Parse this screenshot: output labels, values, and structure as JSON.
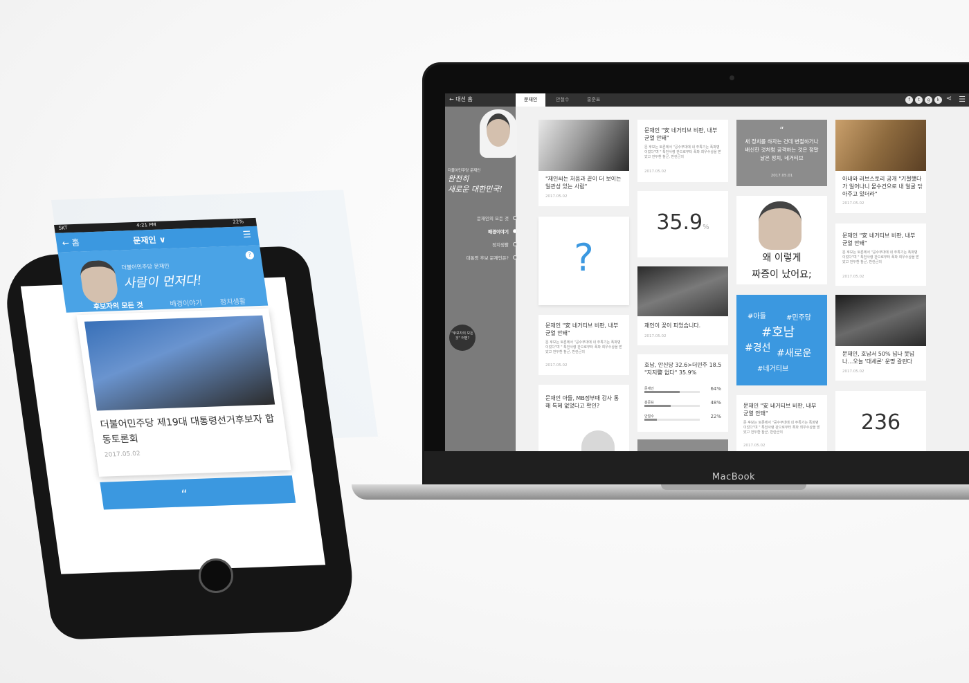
{
  "laptop": {
    "brand": "MacBook",
    "topbar": {
      "back": "대선 홈",
      "tabs": [
        "문재인",
        "안철수",
        "홍준표"
      ],
      "social_icons": [
        "facebook-icon",
        "twitter-icon",
        "googleplus-icon",
        "kakao-icon"
      ]
    },
    "sidebar": {
      "sub": "더불어민주당 문재인",
      "slogan_line1": "완전히",
      "slogan_line2": "새로운 대한민국!",
      "menu": [
        "문재인의 모든 것",
        "배경이야기",
        "정치생활",
        "대통령 후보 문재인은?"
      ],
      "bubble": "\"후보자의 모든것\" 어땐?"
    },
    "cards": {
      "c1_title": "\"재인씨는 처음과 끝이 더 보이는 일관성 있는 사람\"",
      "c1_date": "2017.05.02",
      "c2_title": "문재인 \"安 네거티브 비판, 내부 균열 안돼\"",
      "c2_body": "문 후보는 토론에서 \"공수부대에 내 주특기는 폭파병이었다\"며 \" 특전사령 관으로부터 폭파 최우수상을 받았고 전두환 참군, 반란군의",
      "c2_date": "2017.05.02",
      "c3_quote": "새 정치를 하자는 건데 변절하거나 배신한 것처럼 공격하는 것은 정말 낡은 정치, 네거티브",
      "c3_date": "2017.05.01",
      "c4_title": "아내와 러브스토리 공개 \"기절했다가 일어나니 물수건으로 내 얼굴 닦아주고 있더라\"",
      "c4_date": "2017.05.02",
      "c5_number": "35.9",
      "c5_unit": "%",
      "c6_line1": "왜 이렇게",
      "c6_line2": "짜증이 났어요;",
      "c7_title": "문재인 \"安 네거티브 비판, 내부 균열 안돼\"",
      "c7_body": "문 후보는 토론에서 \"공수부대에 내 주특기는 폭파병이었다\"며 \" 특전사령 관으로부터 폭파 최우수상을 받았고 전두환 참군, 반란군의",
      "c7_date": "2017.05.02",
      "c8_mark": "?",
      "c9_title": "재인이 꽃이 피었습니다.",
      "c9_date": "2017.05.02",
      "c10_tags": [
        "#아들",
        "#민주당",
        "#호남",
        "#경선",
        "#새로운",
        "#네거티브"
      ],
      "c11_title": "문재인, 호남서 50% 넘나 못넘나…오늘 '대세론' 운명 갈린다",
      "c11_date": "2017.05.02",
      "c12_title": "문재인 \"安 네거티브 비판, 내부 균열 안돼\"",
      "c12_body": "문 후보는 토론에서 \"공수부대에 내 주특기는 폭파병이었다\"며 \" 특전사령 관으로부터 폭파 최우수상을 받았고 전두환 참군, 반란군의",
      "c12_date": "2017.05.02",
      "c13_title": "호남, 안신당 32.6>더민주 18.5 \"지지警 없다\" 35.9%",
      "c13_rows": [
        {
          "label": "문재인",
          "pct": "64%",
          "value": 64
        },
        {
          "label": "홍준표",
          "pct": "48%",
          "value": 48
        },
        {
          "label": "안철수",
          "pct": "22%",
          "value": 22
        }
      ],
      "c14_title": "문재인 아들, MB정부때 감사 통해 특혜 없었다고 확인?",
      "c15_title": "문재인 \"安 네거티브 비판, 내부 균열 안돼\"",
      "c15_body": "문 후보는 토론에서 \"공수부대에 내 주특기는 폭파병이었다\"며 \" 특전사령 관으로부터 폭파 최우수상을 받았고 전두환 참군, 반란군의",
      "c15_date": "2017.05.02",
      "c16_number": "236"
    }
  },
  "phone": {
    "status": {
      "carrier": "SKT",
      "time": "4:21 PM",
      "battery": "22%"
    },
    "header": {
      "back": "홈",
      "title": "문재인"
    },
    "hero": {
      "sub": "더불어민주당 문재인",
      "slogan": "사람이 먼저다!",
      "help": "?"
    },
    "tabs": [
      "후보자의 모든 것",
      "배경이야기",
      "정치생활"
    ],
    "feed": {
      "title": "더불어민주당 제19대 대통령선거후보자 합동토론회",
      "date": "2017.05.02"
    }
  },
  "colors": {
    "accent": "#3b98e0",
    "sidebar": "#7b7b7b",
    "topbar": "#323232"
  }
}
